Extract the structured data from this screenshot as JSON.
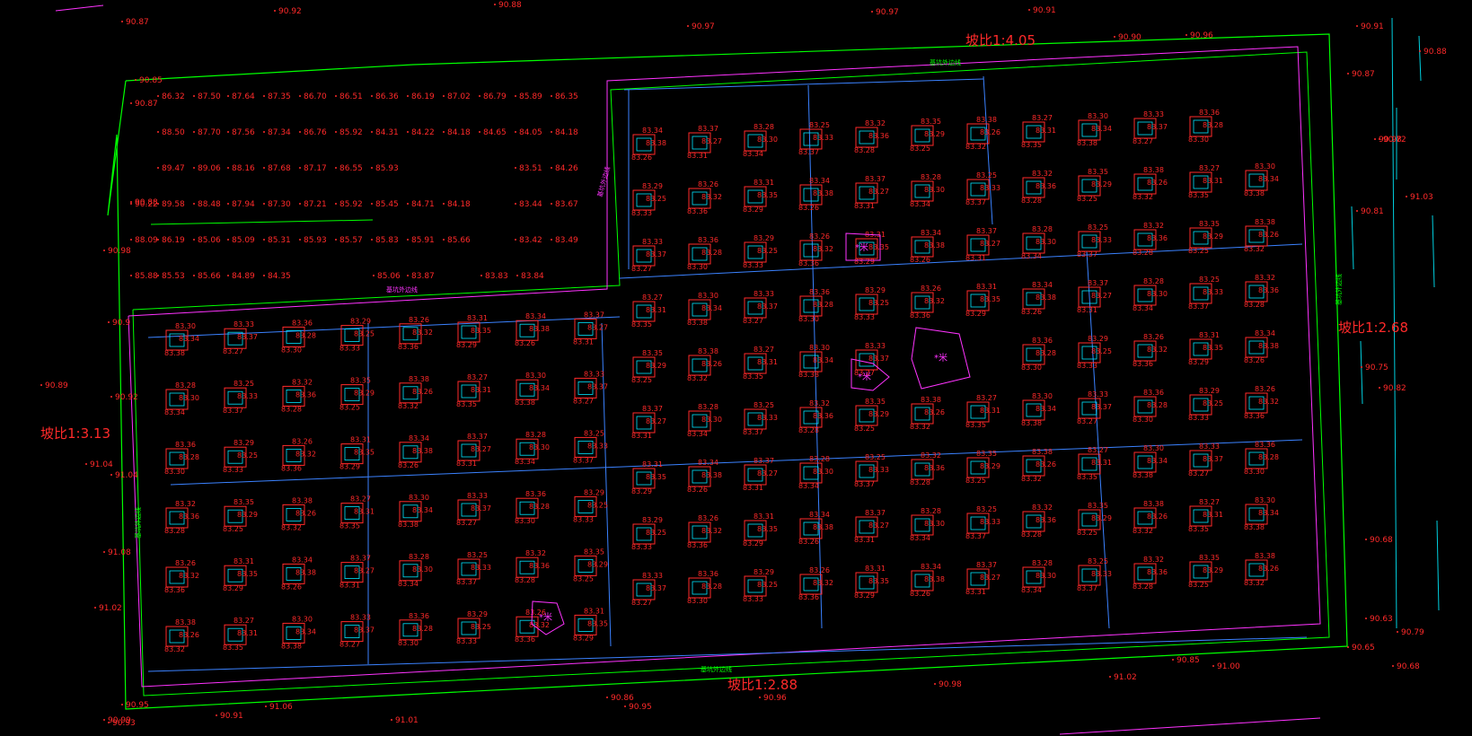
{
  "drawing": {
    "slope_labels": {
      "top": "坡比1:4.05",
      "right": "坡比1:2.68",
      "left": "坡比1:3.13",
      "bottom": "坡比1:2.88"
    },
    "zone_markers": [
      {
        "label": "*米"
      },
      {
        "label": "*米"
      },
      {
        "label": "*米"
      },
      {
        "label": "*米"
      }
    ],
    "boundary_elevations": [
      "90.87",
      "90.92",
      "90.88",
      "90.97",
      "90.97",
      "90.91",
      "90.85",
      "90.87",
      "90.87",
      "90.98",
      "90.88",
      "90.98",
      "90.9",
      "90.89",
      "90.92",
      "91.04",
      "91.04",
      "91.08",
      "91.02",
      "90.95",
      "90.93",
      "90.91",
      "90.99",
      "91.01",
      "91.06",
      "90.86",
      "90.95",
      "90.96",
      "90.98",
      "91.02",
      "91.00",
      "90.85",
      "90.68",
      "90.65",
      "90.63",
      "90.79",
      "90.68",
      "90.75",
      "90.82",
      "91.03",
      "90.81",
      "90.72",
      "90.91",
      "90.88",
      "90.96",
      "90.90"
    ],
    "terrain_elevations": [
      "86.32",
      "87.50",
      "87.64",
      "87.35",
      "86.70",
      "86.51",
      "86.36",
      "86.19",
      "87.02",
      "86.79",
      "85.89",
      "86.35",
      "88.50",
      "87.70",
      "87.56",
      "87.34",
      "86.76",
      "85.92",
      "84.31",
      "84.22",
      "84.18",
      "84.65",
      "84.05",
      "84.18",
      "89.47",
      "89.06",
      "88.16",
      "87.68",
      "87.17",
      "86.55",
      "85.93",
      "83.51",
      "84.26",
      "90.22",
      "89.58",
      "88.48",
      "87.94",
      "87.30",
      "87.21",
      "85.92",
      "85.45",
      "84.71",
      "84.18",
      "83.44",
      "83.67",
      "88.09",
      "86.19",
      "85.06",
      "85.09",
      "85.31",
      "85.93",
      "85.57",
      "85.83",
      "85.91",
      "85.66",
      "83.42",
      "83.49",
      "85.88",
      "85.53",
      "85.66",
      "84.89",
      "84.35",
      "85.06",
      "83.87",
      "83.83",
      "83.84"
    ],
    "pad_elevations": [
      "83.30",
      "83.31",
      "83.32",
      "83.33",
      "83.34",
      "83.35",
      "83.36",
      "83.37",
      "83.38",
      "83.29",
      "83.28",
      "83.27",
      "83.26",
      "83.25"
    ],
    "green_labels": [
      "基坑外边线",
      "基坑外边线",
      "基坑外边线",
      "基坑外边线",
      "基坑外边线",
      "基坑外边线"
    ],
    "colors": {
      "background": "#000000",
      "elevation_text": "#ff2a2a",
      "outer_boundary": "#00ff00",
      "pit_boundary": "#ff33ff",
      "grid_lines": "#3b82ff",
      "pad_inner": "#00e5ff",
      "edge_lines": "#00d0e0"
    }
  }
}
